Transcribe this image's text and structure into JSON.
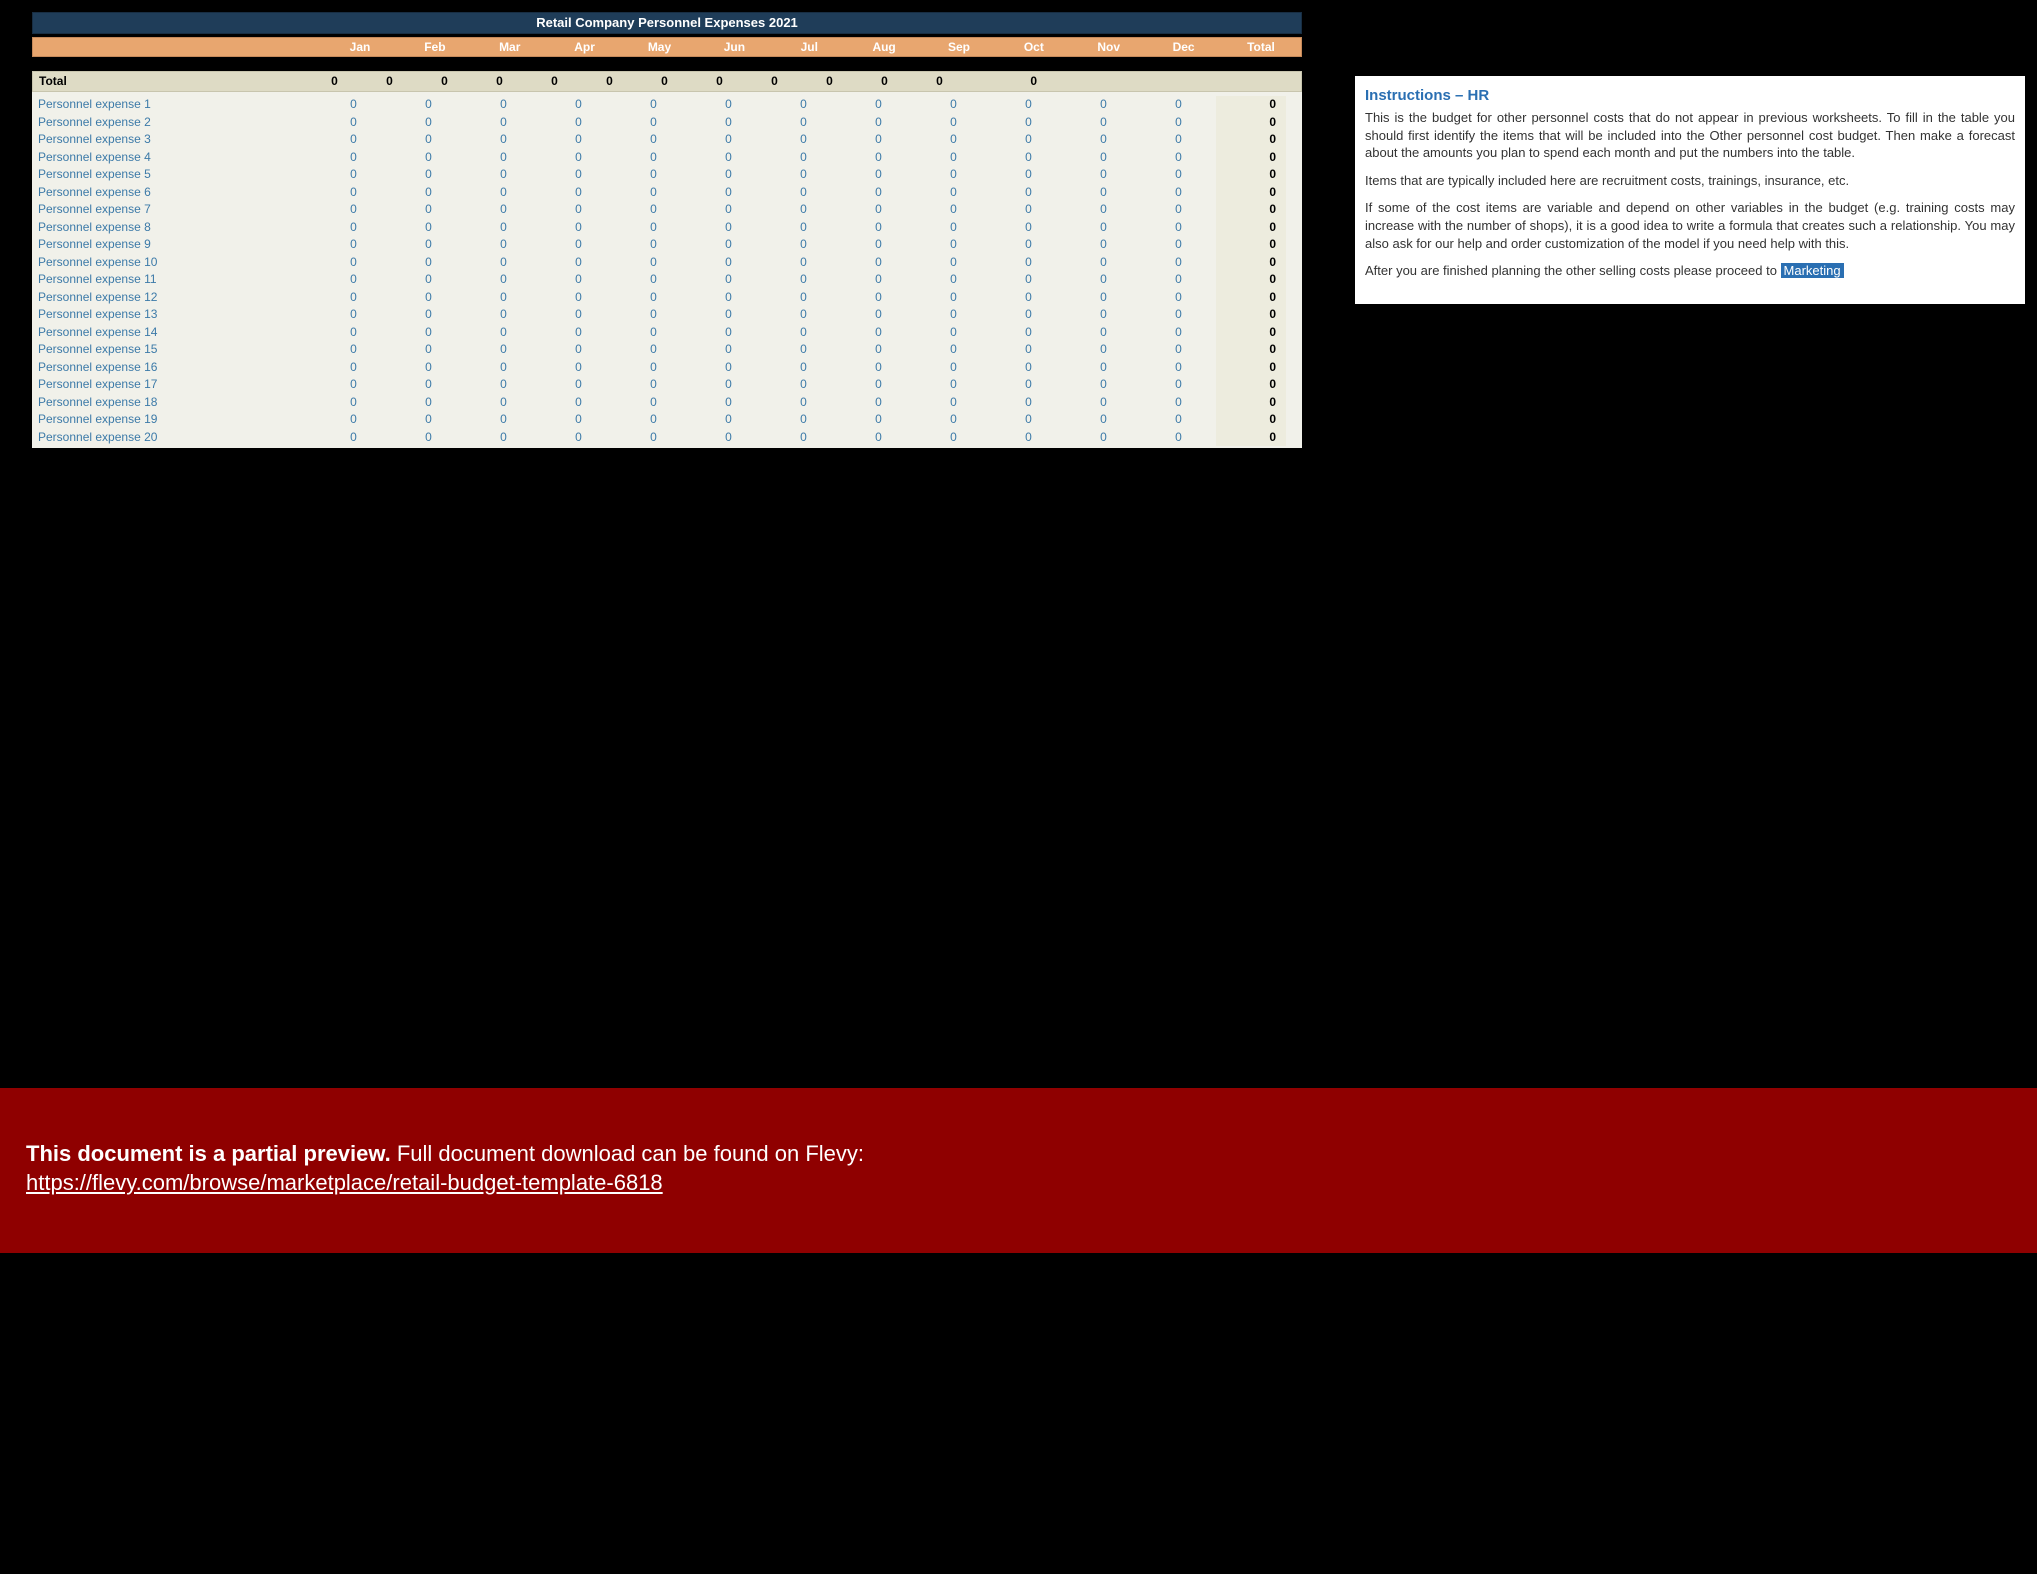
{
  "title": "Retail Company Personnel Expenses 2021",
  "months": [
    "Jan",
    "Feb",
    "Mar",
    "Apr",
    "May",
    "Jun",
    "Jul",
    "Aug",
    "Sep",
    "Oct",
    "Nov",
    "Dec"
  ],
  "total_label": "Total",
  "col_total_label": "Total",
  "totals_row": [
    0,
    0,
    0,
    0,
    0,
    0,
    0,
    0,
    0,
    0,
    0,
    0
  ],
  "totals_sum": 0,
  "rows": [
    {
      "label": "Personnel expense 1",
      "vals": [
        0,
        0,
        0,
        0,
        0,
        0,
        0,
        0,
        0,
        0,
        0,
        0
      ],
      "sum": 0
    },
    {
      "label": "Personnel expense 2",
      "vals": [
        0,
        0,
        0,
        0,
        0,
        0,
        0,
        0,
        0,
        0,
        0,
        0
      ],
      "sum": 0
    },
    {
      "label": "Personnel expense 3",
      "vals": [
        0,
        0,
        0,
        0,
        0,
        0,
        0,
        0,
        0,
        0,
        0,
        0
      ],
      "sum": 0
    },
    {
      "label": "Personnel expense 4",
      "vals": [
        0,
        0,
        0,
        0,
        0,
        0,
        0,
        0,
        0,
        0,
        0,
        0
      ],
      "sum": 0
    },
    {
      "label": "Personnel expense 5",
      "vals": [
        0,
        0,
        0,
        0,
        0,
        0,
        0,
        0,
        0,
        0,
        0,
        0
      ],
      "sum": 0
    },
    {
      "label": "Personnel expense 6",
      "vals": [
        0,
        0,
        0,
        0,
        0,
        0,
        0,
        0,
        0,
        0,
        0,
        0
      ],
      "sum": 0
    },
    {
      "label": "Personnel expense 7",
      "vals": [
        0,
        0,
        0,
        0,
        0,
        0,
        0,
        0,
        0,
        0,
        0,
        0
      ],
      "sum": 0
    },
    {
      "label": "Personnel expense 8",
      "vals": [
        0,
        0,
        0,
        0,
        0,
        0,
        0,
        0,
        0,
        0,
        0,
        0
      ],
      "sum": 0
    },
    {
      "label": "Personnel expense 9",
      "vals": [
        0,
        0,
        0,
        0,
        0,
        0,
        0,
        0,
        0,
        0,
        0,
        0
      ],
      "sum": 0
    },
    {
      "label": "Personnel expense 10",
      "vals": [
        0,
        0,
        0,
        0,
        0,
        0,
        0,
        0,
        0,
        0,
        0,
        0
      ],
      "sum": 0
    },
    {
      "label": "Personnel expense 11",
      "vals": [
        0,
        0,
        0,
        0,
        0,
        0,
        0,
        0,
        0,
        0,
        0,
        0
      ],
      "sum": 0
    },
    {
      "label": "Personnel expense 12",
      "vals": [
        0,
        0,
        0,
        0,
        0,
        0,
        0,
        0,
        0,
        0,
        0,
        0
      ],
      "sum": 0
    },
    {
      "label": "Personnel expense 13",
      "vals": [
        0,
        0,
        0,
        0,
        0,
        0,
        0,
        0,
        0,
        0,
        0,
        0
      ],
      "sum": 0
    },
    {
      "label": "Personnel expense 14",
      "vals": [
        0,
        0,
        0,
        0,
        0,
        0,
        0,
        0,
        0,
        0,
        0,
        0
      ],
      "sum": 0
    },
    {
      "label": "Personnel expense 15",
      "vals": [
        0,
        0,
        0,
        0,
        0,
        0,
        0,
        0,
        0,
        0,
        0,
        0
      ],
      "sum": 0
    },
    {
      "label": "Personnel expense 16",
      "vals": [
        0,
        0,
        0,
        0,
        0,
        0,
        0,
        0,
        0,
        0,
        0,
        0
      ],
      "sum": 0
    },
    {
      "label": "Personnel expense 17",
      "vals": [
        0,
        0,
        0,
        0,
        0,
        0,
        0,
        0,
        0,
        0,
        0,
        0
      ],
      "sum": 0
    },
    {
      "label": "Personnel expense 18",
      "vals": [
        0,
        0,
        0,
        0,
        0,
        0,
        0,
        0,
        0,
        0,
        0,
        0
      ],
      "sum": 0
    },
    {
      "label": "Personnel expense 19",
      "vals": [
        0,
        0,
        0,
        0,
        0,
        0,
        0,
        0,
        0,
        0,
        0,
        0
      ],
      "sum": 0
    },
    {
      "label": "Personnel expense 20",
      "vals": [
        0,
        0,
        0,
        0,
        0,
        0,
        0,
        0,
        0,
        0,
        0,
        0
      ],
      "sum": 0
    }
  ],
  "instructions": {
    "heading": "Instructions – HR",
    "p1": "This is the budget for other personnel costs that do not appear in previous worksheets. To fill in the table you should first identify the items that will be included into the Other personnel cost budget. Then make a forecast about the amounts you plan to spend each month and put the numbers into the table.",
    "p2": "Items that are typically included here are recruitment costs, trainings, insurance, etc.",
    "p3": "If some of the cost items are variable and depend on other variables in the budget (e.g. training costs may increase with the number of shops), it is a good idea to write a formula that creates such a relationship. You may also ask for our help and order customization of the model if you need help with this.",
    "p4_a": "After you are finished planning the other selling costs please proceed to ",
    "p4_link": "Marketing"
  },
  "footer": {
    "bold": "This document is a partial preview.",
    "rest": "  Full document download can be found on Flevy:",
    "url": "https://flevy.com/browse/marketplace/retail-budget-template-6818"
  }
}
